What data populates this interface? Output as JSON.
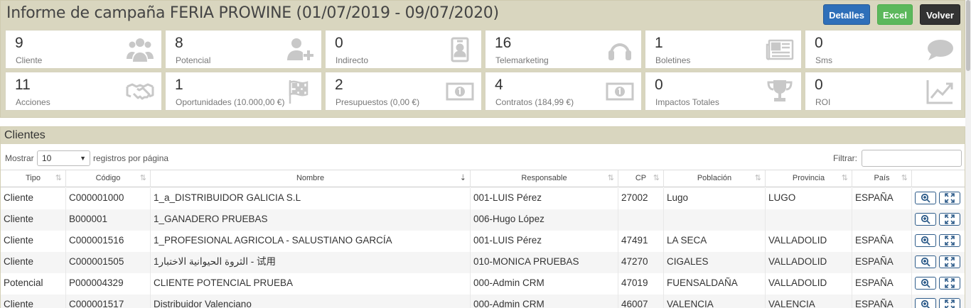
{
  "header": {
    "title": "Informe de campaña FERIA PROWINE (01/07/2019 - 09/07/2020)",
    "buttons": {
      "detalles": "Detalles",
      "excel": "Excel",
      "volver": "Volver"
    }
  },
  "stats": [
    {
      "value": "9",
      "label": "Cliente",
      "icon": "users-icon"
    },
    {
      "value": "8",
      "label": "Potencial",
      "icon": "user-plus-icon"
    },
    {
      "value": "0",
      "label": "Indirecto",
      "icon": "id-badge-icon"
    },
    {
      "value": "16",
      "label": "Telemarketing",
      "icon": "headphones-icon"
    },
    {
      "value": "1",
      "label": "Boletines",
      "icon": "newspaper-icon"
    },
    {
      "value": "0",
      "label": "Sms",
      "icon": "speech-bubble-icon"
    },
    {
      "value": "11",
      "label": "Acciones",
      "icon": "handshake-icon"
    },
    {
      "value": "1",
      "label": "Oportunidades (10.000,00 €)",
      "icon": "flag-checkered-icon"
    },
    {
      "value": "2",
      "label": "Presupuestos (0,00 €)",
      "icon": "money-bill-icon"
    },
    {
      "value": "4",
      "label": "Contratos (184,99 €)",
      "icon": "money-bill-icon"
    },
    {
      "value": "0",
      "label": "Impactos Totales",
      "icon": "trophy-icon"
    },
    {
      "value": "0",
      "label": "ROI",
      "icon": "line-chart-icon"
    }
  ],
  "clientes": {
    "title": "Clientes",
    "mostrar": "Mostrar",
    "page_size": "10",
    "per_page": "registros por página",
    "filtrar": "Filtrar:",
    "filter_value": "",
    "columns": [
      "Tipo",
      "Código",
      "Nombre",
      "Responsable",
      "CP",
      "Población",
      "Provincia",
      "País"
    ],
    "rows": [
      [
        "Cliente",
        "C000001000",
        "1_a_DISTRIBUIDOR GALICIA S.L",
        "001-LUIS Pérez",
        "27002",
        "Lugo",
        "LUGO",
        "ESPAÑA"
      ],
      [
        "Cliente",
        "B000001",
        "1_GANADERO PRUEBAS",
        "006-Hugo López",
        "",
        "",
        "",
        ""
      ],
      [
        "Cliente",
        "C000001516",
        "1_PROFESIONAL AGRICOLA - SALUSTIANO GARCÍA",
        "001-LUIS Pérez",
        "47491",
        "LA SECA",
        "VALLADOLID",
        "ESPAÑA"
      ],
      [
        "Cliente",
        "C000001505",
        "1الثروة الحيوانية الاختبار - 试用",
        "010-MONICA PRUEBAS",
        "47270",
        "CIGALES",
        "VALLADOLID",
        "ESPAÑA"
      ],
      [
        "Potencial",
        "P000004329",
        "CLIENTE POTENCIAL PRUEBA",
        "000-Admin CRM",
        "47019",
        "FUENSALDAÑA",
        "VALLADOLID",
        "ESPAÑA"
      ],
      [
        "Cliente",
        "C000001517",
        "Distribuidor Valenciano",
        "000-Admin CRM",
        "46007",
        "VALENCIA",
        "VALENCIA",
        "ESPAÑA"
      ]
    ]
  }
}
